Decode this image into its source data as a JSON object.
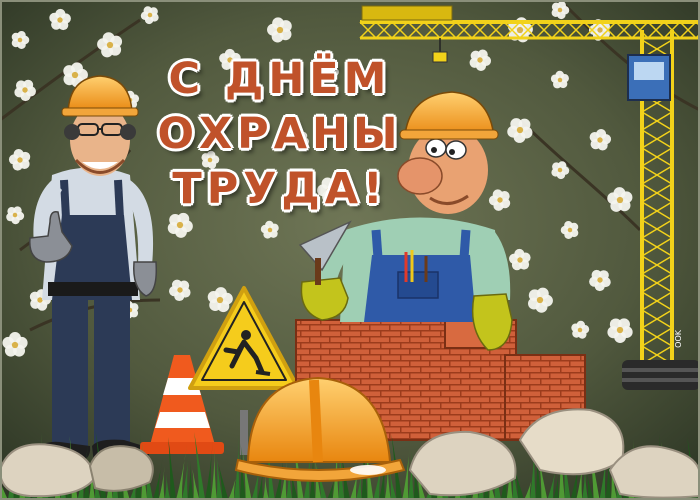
{
  "card": {
    "greeting_lines": [
      "С ДНЁМ",
      "ОХРАНЫ",
      "ТРУДА!"
    ],
    "watermark": "OOK",
    "colors": {
      "background": "#51593e",
      "blossom": "#f4f4ee",
      "title_text": "#c0522a",
      "title_outline": "#ffffff",
      "crane": "#f2d21a",
      "helmet": "#f59a18",
      "brick": "#d0603a",
      "overalls_left": "#2c3a56",
      "overalls_right": "#2f5aa8",
      "grass": "#2f7a2a"
    },
    "icons": [
      "blossom-icon",
      "construction-crane-icon",
      "worker-icon",
      "bricklayer-icon",
      "traffic-cone-icon",
      "road-work-sign-icon",
      "hard-hat-icon",
      "brick-wall-icon",
      "rock-icon"
    ]
  }
}
